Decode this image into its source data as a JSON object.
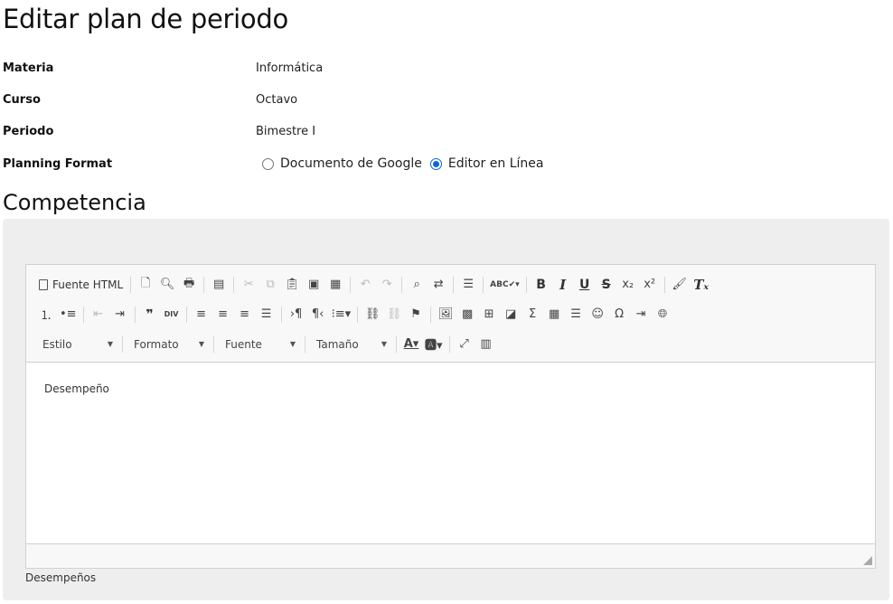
{
  "page": {
    "title": "Editar plan de periodo",
    "section_title": "Competencia",
    "help_text": "Desempeños"
  },
  "info": {
    "materia": {
      "label": "Materia",
      "value": "Informática"
    },
    "curso": {
      "label": "Curso",
      "value": "Octavo"
    },
    "periodo": {
      "label": "Periodo",
      "value": "Bimestre I"
    },
    "format": {
      "label": "Planning Format",
      "options": [
        {
          "label": "Documento de Google",
          "selected": false
        },
        {
          "label": "Editor en Línea",
          "selected": true
        }
      ]
    }
  },
  "toolbar": {
    "source_label": "Fuente HTML",
    "style_combo": "Estilo",
    "format_combo": "Formato",
    "font_combo": "Fuente",
    "size_combo": "Tamaño",
    "spell_label": "ABC",
    "div_label": "DIV"
  },
  "editor": {
    "content": "Desempeño"
  },
  "colors": {
    "accent": "#0a66e0",
    "panel_bg": "#eeeeee",
    "toolbar_bg": "#f8f8f8",
    "border": "#d1d1d1"
  }
}
